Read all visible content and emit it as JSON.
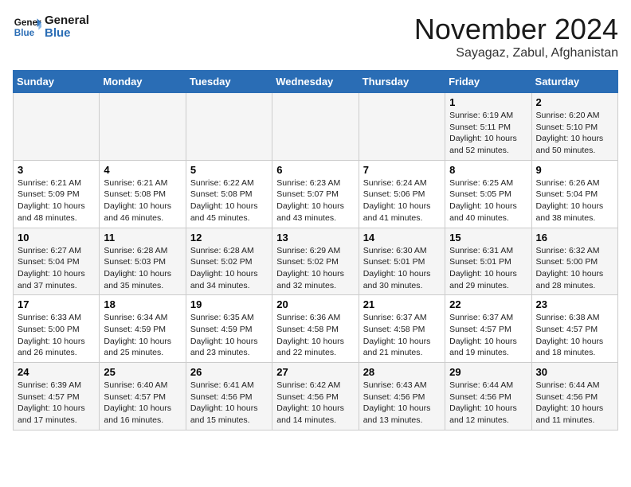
{
  "header": {
    "logo_line1": "General",
    "logo_line2": "Blue",
    "month": "November 2024",
    "location": "Sayagaz, Zabul, Afghanistan"
  },
  "weekdays": [
    "Sunday",
    "Monday",
    "Tuesday",
    "Wednesday",
    "Thursday",
    "Friday",
    "Saturday"
  ],
  "weeks": [
    [
      {
        "day": "",
        "info": ""
      },
      {
        "day": "",
        "info": ""
      },
      {
        "day": "",
        "info": ""
      },
      {
        "day": "",
        "info": ""
      },
      {
        "day": "",
        "info": ""
      },
      {
        "day": "1",
        "info": "Sunrise: 6:19 AM\nSunset: 5:11 PM\nDaylight: 10 hours and 52 minutes."
      },
      {
        "day": "2",
        "info": "Sunrise: 6:20 AM\nSunset: 5:10 PM\nDaylight: 10 hours and 50 minutes."
      }
    ],
    [
      {
        "day": "3",
        "info": "Sunrise: 6:21 AM\nSunset: 5:09 PM\nDaylight: 10 hours and 48 minutes."
      },
      {
        "day": "4",
        "info": "Sunrise: 6:21 AM\nSunset: 5:08 PM\nDaylight: 10 hours and 46 minutes."
      },
      {
        "day": "5",
        "info": "Sunrise: 6:22 AM\nSunset: 5:08 PM\nDaylight: 10 hours and 45 minutes."
      },
      {
        "day": "6",
        "info": "Sunrise: 6:23 AM\nSunset: 5:07 PM\nDaylight: 10 hours and 43 minutes."
      },
      {
        "day": "7",
        "info": "Sunrise: 6:24 AM\nSunset: 5:06 PM\nDaylight: 10 hours and 41 minutes."
      },
      {
        "day": "8",
        "info": "Sunrise: 6:25 AM\nSunset: 5:05 PM\nDaylight: 10 hours and 40 minutes."
      },
      {
        "day": "9",
        "info": "Sunrise: 6:26 AM\nSunset: 5:04 PM\nDaylight: 10 hours and 38 minutes."
      }
    ],
    [
      {
        "day": "10",
        "info": "Sunrise: 6:27 AM\nSunset: 5:04 PM\nDaylight: 10 hours and 37 minutes."
      },
      {
        "day": "11",
        "info": "Sunrise: 6:28 AM\nSunset: 5:03 PM\nDaylight: 10 hours and 35 minutes."
      },
      {
        "day": "12",
        "info": "Sunrise: 6:28 AM\nSunset: 5:02 PM\nDaylight: 10 hours and 34 minutes."
      },
      {
        "day": "13",
        "info": "Sunrise: 6:29 AM\nSunset: 5:02 PM\nDaylight: 10 hours and 32 minutes."
      },
      {
        "day": "14",
        "info": "Sunrise: 6:30 AM\nSunset: 5:01 PM\nDaylight: 10 hours and 30 minutes."
      },
      {
        "day": "15",
        "info": "Sunrise: 6:31 AM\nSunset: 5:01 PM\nDaylight: 10 hours and 29 minutes."
      },
      {
        "day": "16",
        "info": "Sunrise: 6:32 AM\nSunset: 5:00 PM\nDaylight: 10 hours and 28 minutes."
      }
    ],
    [
      {
        "day": "17",
        "info": "Sunrise: 6:33 AM\nSunset: 5:00 PM\nDaylight: 10 hours and 26 minutes."
      },
      {
        "day": "18",
        "info": "Sunrise: 6:34 AM\nSunset: 4:59 PM\nDaylight: 10 hours and 25 minutes."
      },
      {
        "day": "19",
        "info": "Sunrise: 6:35 AM\nSunset: 4:59 PM\nDaylight: 10 hours and 23 minutes."
      },
      {
        "day": "20",
        "info": "Sunrise: 6:36 AM\nSunset: 4:58 PM\nDaylight: 10 hours and 22 minutes."
      },
      {
        "day": "21",
        "info": "Sunrise: 6:37 AM\nSunset: 4:58 PM\nDaylight: 10 hours and 21 minutes."
      },
      {
        "day": "22",
        "info": "Sunrise: 6:37 AM\nSunset: 4:57 PM\nDaylight: 10 hours and 19 minutes."
      },
      {
        "day": "23",
        "info": "Sunrise: 6:38 AM\nSunset: 4:57 PM\nDaylight: 10 hours and 18 minutes."
      }
    ],
    [
      {
        "day": "24",
        "info": "Sunrise: 6:39 AM\nSunset: 4:57 PM\nDaylight: 10 hours and 17 minutes."
      },
      {
        "day": "25",
        "info": "Sunrise: 6:40 AM\nSunset: 4:57 PM\nDaylight: 10 hours and 16 minutes."
      },
      {
        "day": "26",
        "info": "Sunrise: 6:41 AM\nSunset: 4:56 PM\nDaylight: 10 hours and 15 minutes."
      },
      {
        "day": "27",
        "info": "Sunrise: 6:42 AM\nSunset: 4:56 PM\nDaylight: 10 hours and 14 minutes."
      },
      {
        "day": "28",
        "info": "Sunrise: 6:43 AM\nSunset: 4:56 PM\nDaylight: 10 hours and 13 minutes."
      },
      {
        "day": "29",
        "info": "Sunrise: 6:44 AM\nSunset: 4:56 PM\nDaylight: 10 hours and 12 minutes."
      },
      {
        "day": "30",
        "info": "Sunrise: 6:44 AM\nSunset: 4:56 PM\nDaylight: 10 hours and 11 minutes."
      }
    ]
  ]
}
